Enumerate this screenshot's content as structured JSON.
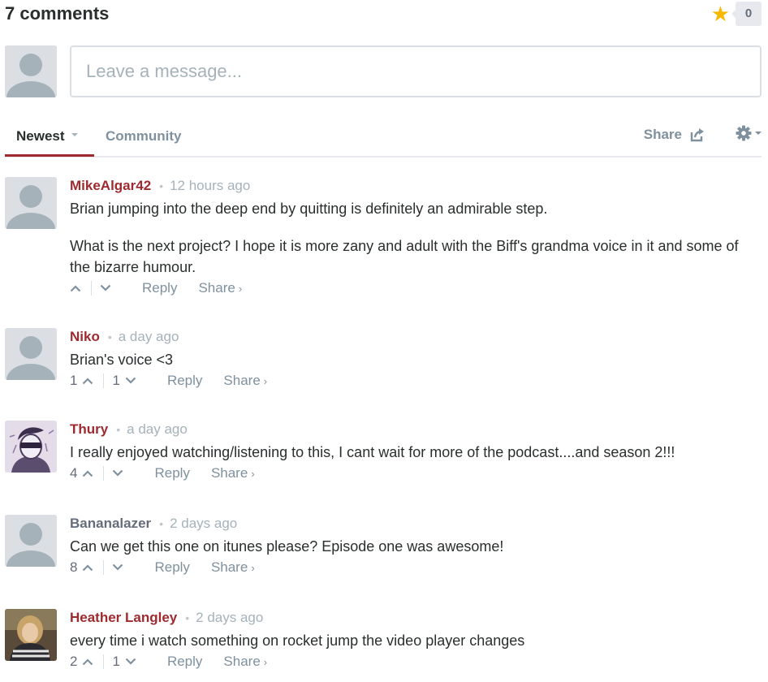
{
  "header": {
    "comment_count": "7 comments",
    "favorite_count": "0"
  },
  "compose": {
    "placeholder": "Leave a message..."
  },
  "nav": {
    "tab_newest": "Newest",
    "tab_community": "Community",
    "share": "Share"
  },
  "comments": [
    {
      "author": "MikeAlgar42",
      "time": "12 hours ago",
      "paragraphs": [
        "Brian jumping into the deep end by quitting is definitely an admirable step.",
        "What is the next project? I hope it is more zany and adult with the Biff's grandma voice in it and some of the bizarre humour."
      ],
      "upvotes": "",
      "downvotes": "",
      "reply": "Reply",
      "share": "Share"
    },
    {
      "author": "Niko",
      "time": "a day ago",
      "paragraphs": [
        "Brian's voice <3"
      ],
      "upvotes": "1",
      "downvotes": "1",
      "reply": "Reply",
      "share": "Share"
    },
    {
      "author": "Thury",
      "time": "a day ago",
      "paragraphs": [
        "I really enjoyed watching/listening to this, I cant wait for more of the podcast....and season 2!!!"
      ],
      "upvotes": "4",
      "downvotes": "",
      "reply": "Reply",
      "share": "Share"
    },
    {
      "author": "Bananalazer",
      "time": "2 days ago",
      "paragraphs": [
        "Can we get this one on itunes please? Episode one was awesome!"
      ],
      "upvotes": "8",
      "downvotes": "",
      "reply": "Reply",
      "share": "Share"
    },
    {
      "author": "Heather Langley",
      "time": "2 days ago",
      "paragraphs": [
        "every time i watch something on rocket jump the video player changes"
      ],
      "upvotes": "2",
      "downvotes": "1",
      "reply": "Reply",
      "share": "Share"
    }
  ],
  "colors": {
    "accent": "#9e2a2f",
    "star": "#f7b900",
    "muted": "#7f919e"
  }
}
